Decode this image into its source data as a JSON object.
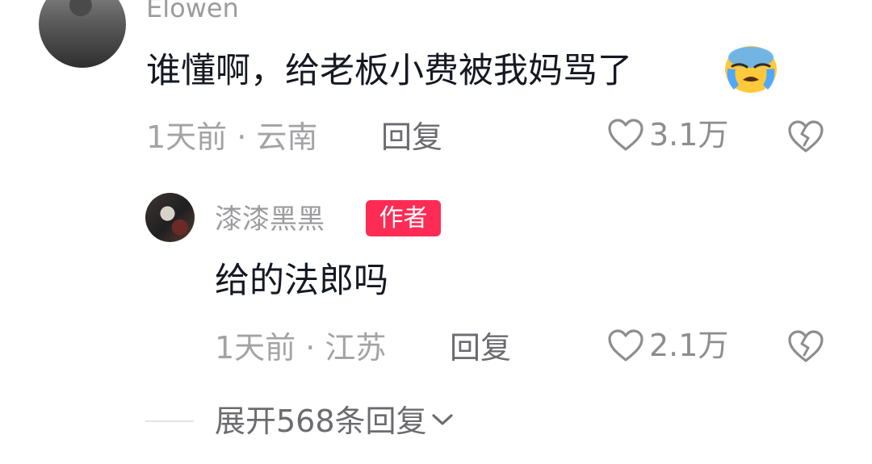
{
  "main_comment": {
    "username": "Elowen",
    "text": "谁懂啊，给老板小费被我妈骂了",
    "emoji": "loudly-crying-face",
    "time_location": "1天前 · 云南",
    "reply_label": "回复",
    "likes": "3.1万"
  },
  "reply_comment": {
    "username": "漆漆黑黑",
    "badge": "作者",
    "text": "给的法郎吗",
    "time_location": "1天前 · 江苏",
    "reply_label": "回复",
    "likes": "2.1万"
  },
  "expand": {
    "label": "展开568条回复"
  },
  "colors": {
    "badge": "#fe2c55",
    "text": "#161823",
    "muted": "#a3a3a6"
  }
}
